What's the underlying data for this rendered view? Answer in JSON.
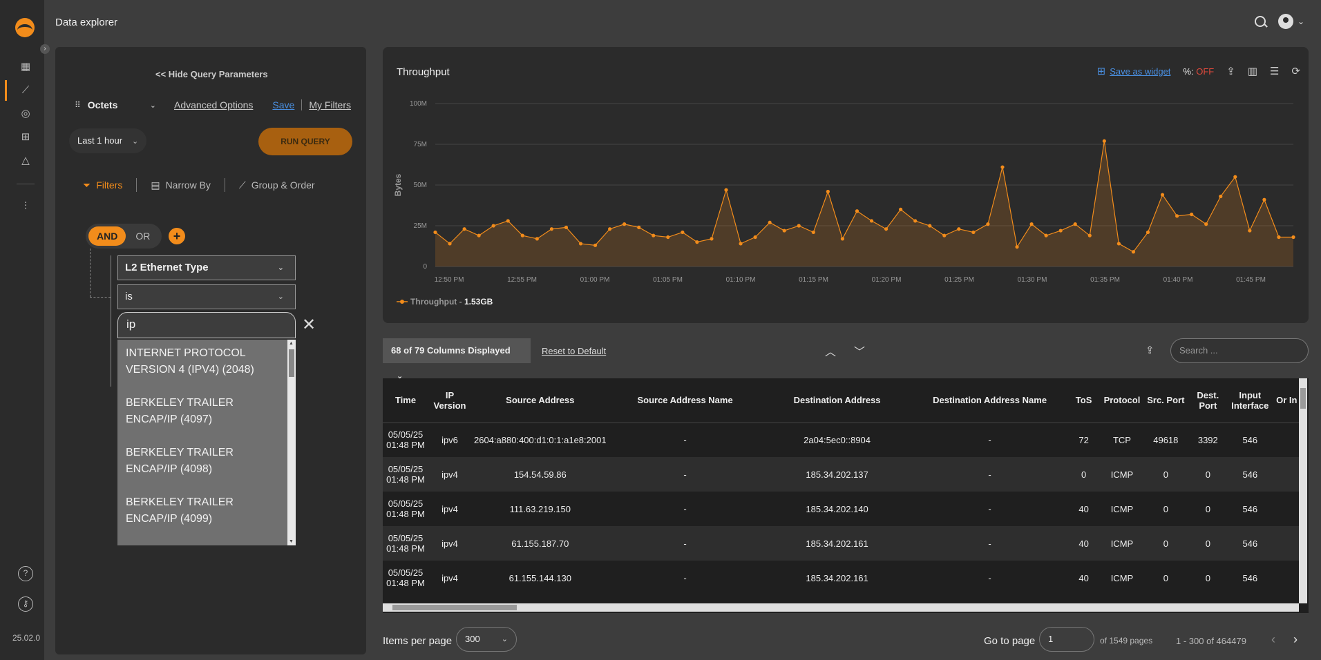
{
  "app": {
    "title": "Data explorer",
    "version": "25.02.0"
  },
  "rail": {
    "icons": [
      "dashboard-icon",
      "chart-icon",
      "globe-icon",
      "sitemap-icon",
      "bell-icon",
      "sliders-icon",
      "help-icon",
      "key-icon"
    ]
  },
  "query": {
    "hide_label": "Hide Query Parameters",
    "metric": "Octets",
    "advanced": "Advanced Options",
    "save": "Save",
    "my_filters": "My Filters",
    "time_range": "Last 1 hour",
    "run": "RUN QUERY",
    "tabs": [
      "Filters",
      "Narrow By",
      "Group & Order"
    ],
    "and_label": "AND",
    "or_label": "OR",
    "add": "+",
    "field": "L2 Ethernet Type",
    "operator": "is",
    "value": "ip",
    "options": [
      "INTERNET PROTOCOL VERSION 4 (IPV4) (2048)",
      "BERKELEY TRAILER ENCAP/IP (4097)",
      "BERKELEY TRAILER ENCAP/IP (4098)",
      "BERKELEY TRAILER ENCAP/IP (4099)"
    ]
  },
  "chart": {
    "title": "Throughput",
    "save_widget": "Save as widget",
    "pct_label": "%:",
    "pct_value": "OFF",
    "accent": "#f28c1b",
    "legend_name": "Throughput -",
    "legend_total": "1.53GB",
    "chart_data": {
      "type": "area",
      "title": "Throughput",
      "ylabel": "Bytes",
      "xlabel": "",
      "ylim": [
        0,
        100000000
      ],
      "y_ticks": [
        "0",
        "25M",
        "50M",
        "75M",
        "100M"
      ],
      "x_ticks": [
        "12:50 PM",
        "12:55 PM",
        "01:00 PM",
        "01:05 PM",
        "01:10 PM",
        "01:15 PM",
        "01:20 PM",
        "01:25 PM",
        "01:30 PM",
        "01:35 PM",
        "01:40 PM",
        "01:45 PM"
      ],
      "series": [
        {
          "name": "Throughput",
          "values": [
            21,
            14,
            23,
            19,
            25,
            28,
            19,
            17,
            23,
            24,
            14,
            13,
            23,
            26,
            24,
            19,
            18,
            21,
            15,
            17,
            47,
            14,
            18,
            27,
            22,
            25,
            21,
            46,
            17,
            34,
            28,
            23,
            35,
            28,
            25,
            19,
            23,
            21,
            26,
            61,
            12,
            26,
            19,
            22,
            26,
            19,
            77,
            14,
            9,
            21,
            44,
            31,
            32,
            26,
            43,
            55,
            22,
            41,
            18,
            18
          ]
        }
      ]
    }
  },
  "table_bar": {
    "columns_displayed": "68 of 79 Columns Displayed",
    "reset": "Reset to Default",
    "search_placeholder": "Search ..."
  },
  "table": {
    "headers": [
      "Time",
      "IP Version",
      "Source Address",
      "Source Address Name",
      "Destination Address",
      "Destination Address Name",
      "ToS",
      "Protocol",
      "Src. Port",
      "Dest. Port",
      "Input Interface",
      "Or In"
    ],
    "rows": [
      [
        "05/05/25 01:48 PM",
        "ipv6",
        "2604:a880:400:d1:0:1:a1e8:2001",
        "-",
        "2a04:5ec0::8904",
        "-",
        "72",
        "TCP",
        "49618",
        "3392",
        "546",
        ""
      ],
      [
        "05/05/25 01:48 PM",
        "ipv4",
        "154.54.59.86",
        "-",
        "185.34.202.137",
        "-",
        "0",
        "ICMP",
        "0",
        "0",
        "546",
        ""
      ],
      [
        "05/05/25 01:48 PM",
        "ipv4",
        "111.63.219.150",
        "-",
        "185.34.202.140",
        "-",
        "40",
        "ICMP",
        "0",
        "0",
        "546",
        ""
      ],
      [
        "05/05/25 01:48 PM",
        "ipv4",
        "61.155.187.70",
        "-",
        "185.34.202.161",
        "-",
        "40",
        "ICMP",
        "0",
        "0",
        "546",
        ""
      ],
      [
        "05/05/25 01:48 PM",
        "ipv4",
        "61.155.144.130",
        "-",
        "185.34.202.161",
        "-",
        "40",
        "ICMP",
        "0",
        "0",
        "546",
        ""
      ]
    ]
  },
  "pager": {
    "items_label": "Items per page",
    "items_value": "300",
    "goto_label": "Go to page",
    "goto_value": "1",
    "of_pages": "of 1549 pages",
    "range": "1 - 300 of 464479"
  }
}
